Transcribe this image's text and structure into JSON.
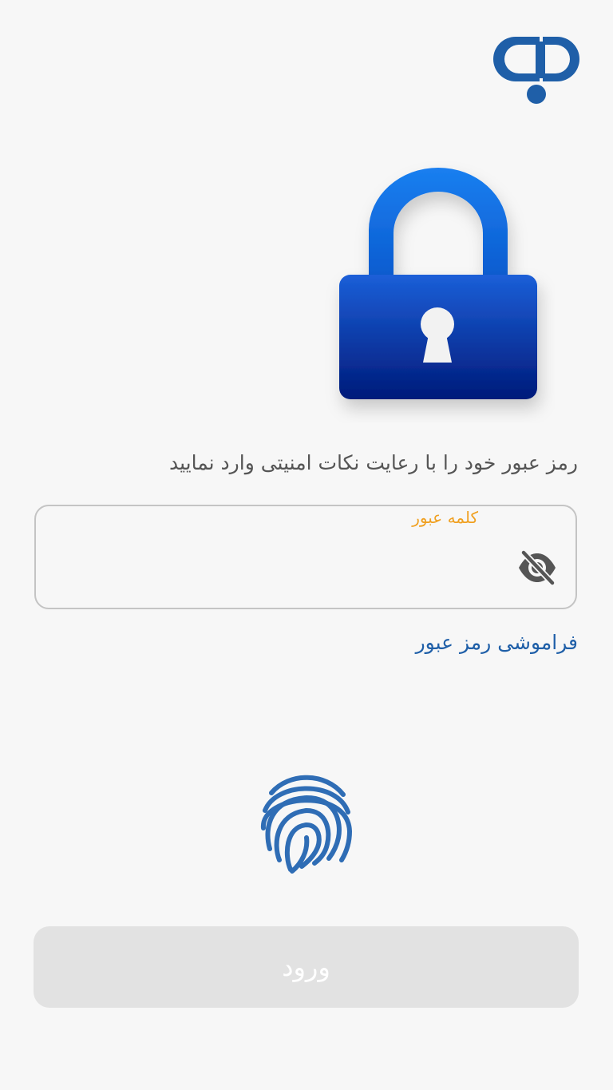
{
  "app": {
    "logo_icon": "bank-refah-logo-icon",
    "brand_color": "#1f5fa8"
  },
  "hero": {
    "icon": "padlock-icon"
  },
  "login": {
    "instruction": "رمز عبور خود را با رعایت نکات امنیتی وارد نمایید",
    "password_label": "کلمه عبور",
    "password_value": "",
    "visibility_icon": "eye-off-icon",
    "forgot_password": "فراموشی رمز عبور",
    "fingerprint_icon": "fingerprint-icon",
    "submit_label": "ورود",
    "label_color": "#f0a020",
    "submit_state": "disabled"
  }
}
